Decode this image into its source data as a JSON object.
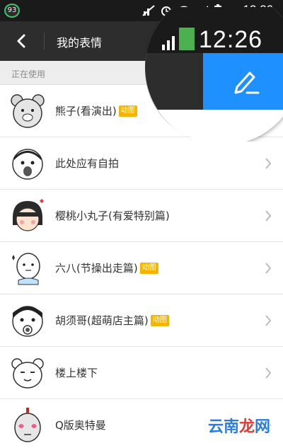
{
  "status_bar": {
    "battery_badge": "93",
    "time": "12:26"
  },
  "header": {
    "title": "我的表情"
  },
  "magnifier": {
    "time": "12:26"
  },
  "section": {
    "label": "正在使用"
  },
  "sticker_list": [
    {
      "name": "熊子(看演出)",
      "tag": "动图"
    },
    {
      "name": "此处应有自拍",
      "tag": ""
    },
    {
      "name": "樱桃小丸子(有爱特别篇)",
      "tag": ""
    },
    {
      "name": "六八(节操出走篇)",
      "tag": "动图"
    },
    {
      "name": "胡须哥(超萌店主篇)",
      "tag": "动图"
    },
    {
      "name": "楼上楼下",
      "tag": ""
    },
    {
      "name": "Q版奥特曼",
      "tag": ""
    }
  ],
  "watermark": {
    "text_blue": "云南",
    "text_red": "龙",
    "text_blue2": "网"
  },
  "colors": {
    "accent_blue": "#1e90ff",
    "tag_orange": "#f4b400",
    "header_bg": "#2d2d2d"
  }
}
